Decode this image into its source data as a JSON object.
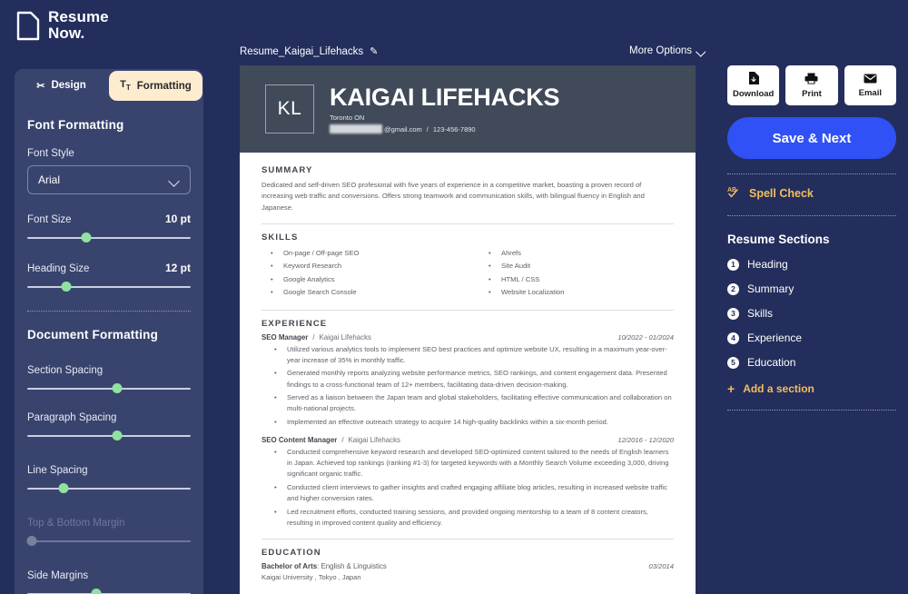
{
  "brand": {
    "line1": "Resume",
    "line2": "Now.",
    "logo_icon": "document-page-icon"
  },
  "left_panel": {
    "tabs": [
      {
        "label": "Design",
        "icon": "paintbrush-icon",
        "active": false
      },
      {
        "label": "Formatting",
        "icon": "text-size-icon",
        "active": true
      }
    ],
    "font_formatting": {
      "heading": "Font Formatting",
      "font_style_label": "Font Style",
      "font_style_value": "Arial",
      "font_style_options": [
        "Arial"
      ],
      "sliders": [
        {
          "label": "Font Size",
          "value": "10 pt",
          "percent": 36,
          "disabled": false
        },
        {
          "label": "Heading Size",
          "value": "12 pt",
          "percent": 24,
          "disabled": false
        }
      ]
    },
    "document_formatting": {
      "heading": "Document Formatting",
      "sliders": [
        {
          "label": "Section Spacing",
          "value": "",
          "percent": 55,
          "disabled": false
        },
        {
          "label": "Paragraph Spacing",
          "value": "",
          "percent": 55,
          "disabled": false
        },
        {
          "label": "Line Spacing",
          "value": "",
          "percent": 22,
          "disabled": false
        },
        {
          "label": "Top & Bottom Margin",
          "value": "",
          "percent": 2,
          "disabled": true
        },
        {
          "label": "Side Margins",
          "value": "",
          "percent": 42,
          "disabled": false
        }
      ]
    }
  },
  "doc_bar": {
    "file_name": "Resume_Kaigai_Lifehacks",
    "edit_icon": "pencil-icon",
    "more_options": "More Options",
    "more_options_icon": "chevron-down-icon"
  },
  "resume": {
    "initials": "KL",
    "name": "KAIGAI LIFEHACKS",
    "location": "Toronto ON",
    "email_suffix": "@gmail.com",
    "contact_separator": "/",
    "phone": "123-456-7890",
    "summary": {
      "title": "SUMMARY",
      "text": "Dedicated and self-driven SEO profesional with five years of experience in a competitive market, boasting a proven record of increasing web traffic and conversions. Offers strong teamwork and communication skills, with bilingual fluency in English and Japanese."
    },
    "skills": {
      "title": "SKILLS",
      "column_left": [
        "On-page / Off-page SEO",
        "Keyword Research",
        "Google Analytics",
        "Google Search Console"
      ],
      "column_right": [
        "Ahrefs",
        "Site Audit",
        "HTML / CSS",
        "Website Localization"
      ]
    },
    "experience": {
      "title": "EXPERIENCE",
      "jobs": [
        {
          "role": "SEO Manager",
          "separator": "/",
          "company": "Kaigai Lifehacks",
          "dates": "10/2022 - 01/2024",
          "bullets": [
            "Utilized various analytics tools to implement SEO best practices and optimize website UX, resulting in a maximum year-over-year increase of 35% in monthly traffic.",
            "Generated monthly reports analyzing website performance metrics, SEO rankings, and content engagement data. Presented findings to a cross-functional team of 12+ members, facilitating data-driven decision-making.",
            "Served as a liaison between the Japan team and global stakeholders, facilitating effective communication and collaboration on multi-national projects.",
            "Implemented an effective outreach strategy to acquire 14 high-quality backlinks within a six-month period."
          ]
        },
        {
          "role": "SEO Content Manager",
          "separator": "/",
          "company": "Kaigai Lifehacks",
          "dates": "12/2016 - 12/2020",
          "bullets": [
            "Conducted comprehensive keyword research and developed SEO-optimized content tailored to the needs of English learners in Japan. Achieved top rankings (ranking #1-3) for targeted keywords with a Monthly Search Volume exceeding 3,000, driving significant organic traffic.",
            "Conducted client interviews to gather insights and crafted engaging affiliate blog articles, resulting in increased website traffic and higher conversion rates.",
            "Led recruitment efforts, conducted training sessions, and provided ongoing mentorship to a team of 8 content creators, resulting in improved content quality and efficiency."
          ]
        }
      ]
    },
    "education": {
      "title": "EDUCATION",
      "degree_bold": "Bachelor of Arts",
      "degree_rest": ": English & Linguistics",
      "date": "03/2014",
      "school": "Kaigai University , Tokyo , Japan"
    }
  },
  "right_panel": {
    "actions": [
      {
        "label": "Download",
        "icon": "download-file-icon"
      },
      {
        "label": "Print",
        "icon": "printer-icon"
      },
      {
        "label": "Email",
        "icon": "envelope-icon"
      }
    ],
    "save_next": "Save & Next",
    "spell_check": {
      "label": "Spell Check",
      "icon": "spell-check-icon"
    },
    "sections_title": "Resume Sections",
    "sections": [
      {
        "num": "1",
        "label": "Heading"
      },
      {
        "num": "2",
        "label": "Summary"
      },
      {
        "num": "3",
        "label": "Skills"
      },
      {
        "num": "4",
        "label": "Experience"
      },
      {
        "num": "5",
        "label": "Education"
      }
    ],
    "add_section": {
      "label": "Add a section",
      "icon": "plus-icon"
    }
  },
  "colors": {
    "app_background": "#232e5c",
    "panel_background": "#39446e",
    "accent_blue": "#2f51f5",
    "accent_gold": "#f4bd5e",
    "tab_active": "#fdecd0",
    "slider_thumb": "#8fe3a0",
    "resume_header": "#414a59"
  }
}
